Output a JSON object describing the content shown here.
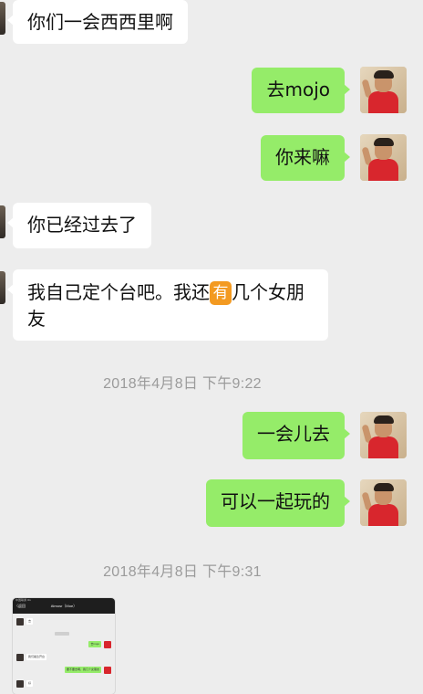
{
  "messages": {
    "m1": "你们一会西西里啊",
    "m2": "去mojo",
    "m3": "你来嘛",
    "m4": "你已经过去了",
    "m5_part1": "我自己定个台吧。我还",
    "m5_emoji": "有",
    "m5_part2": "几个女朋友",
    "m6": "一会儿去",
    "m7": "可以一起玩的"
  },
  "timestamps": {
    "t1": "2018年4月8日 下午9:22",
    "t2": "2018年4月8日 下午9:31"
  },
  "thumbnail": {
    "status": "中国联通 4G",
    "back_label": "〈返回",
    "title": "Atmosr（Moe）",
    "msg1": "去",
    "msg2": "去mojo",
    "msg3": "我们着急开台",
    "msg4": "要不要去啊，我几个女朋友",
    "msg5": "好"
  },
  "colors": {
    "background": "#ededed",
    "sent_bubble": "#95ec69",
    "received_bubble": "#ffffff",
    "emoji_tile": "#f39a21",
    "timestamp_text": "#9b9b9b"
  }
}
